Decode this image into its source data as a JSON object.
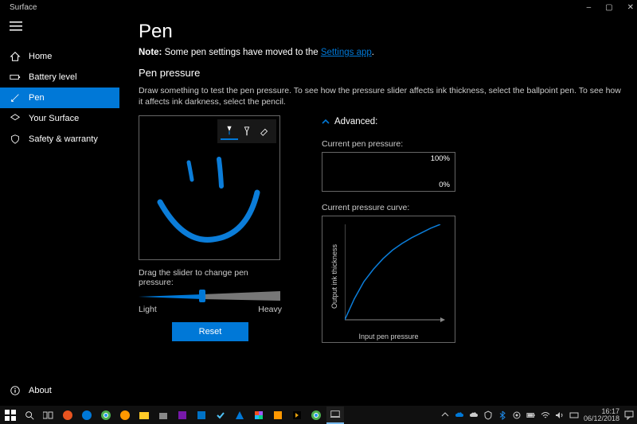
{
  "app": {
    "title": "Surface"
  },
  "window": {
    "minimize": "–",
    "maximize": "▢",
    "close": "✕"
  },
  "sidebar": {
    "items": [
      {
        "label": "Home"
      },
      {
        "label": "Battery level"
      },
      {
        "label": "Pen"
      },
      {
        "label": "Your Surface"
      },
      {
        "label": "Safety & warranty"
      }
    ],
    "about": "About"
  },
  "page": {
    "title": "Pen",
    "note_bold": "Note:",
    "note_text": " Some pen settings have moved to the ",
    "note_link": "Settings app",
    "note_period": ".",
    "subheading": "Pen pressure",
    "instruction": "Draw something to test the pen pressure. To see how the pressure slider affects ink thickness, select the ballpoint pen. To see how it affects ink darkness, select the pencil.",
    "drag_label": "Drag the slider to change pen pressure:",
    "slider": {
      "light": "Light",
      "heavy": "Heavy",
      "value": 0.43
    },
    "reset": "Reset",
    "advanced": "Advanced:",
    "pressure_label": "Current pen pressure:",
    "pressure": {
      "hundred": "100%",
      "zero": "0%"
    },
    "curve_label": "Current pressure curve:",
    "curve": {
      "xlabel": "Input pen pressure",
      "ylabel": "Output ink thickness"
    }
  },
  "chart_data": {
    "type": "line",
    "title": "Current pressure curve",
    "xlabel": "Input pen pressure",
    "ylabel": "Output ink thickness",
    "xlim": [
      0,
      1
    ],
    "ylim": [
      0,
      1
    ],
    "x": [
      0.0,
      0.1,
      0.2,
      0.3,
      0.4,
      0.5,
      0.6,
      0.7,
      0.8,
      0.9,
      1.0
    ],
    "values": [
      0.0,
      0.22,
      0.4,
      0.53,
      0.64,
      0.73,
      0.8,
      0.86,
      0.91,
      0.96,
      1.0
    ]
  },
  "taskbar": {
    "time": "16:17",
    "date": "06/12/2018"
  }
}
